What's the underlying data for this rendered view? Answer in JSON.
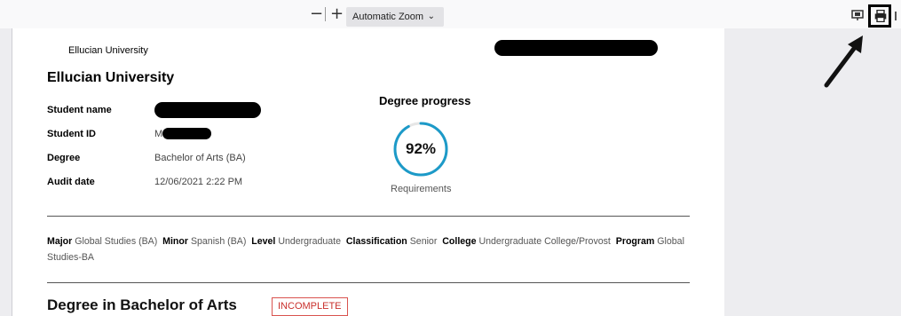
{
  "toolbar": {
    "zoom_out": "−",
    "zoom_in": "+",
    "zoom_value": "Automatic Zoom",
    "zoom_chevron": "⌄"
  },
  "page": {
    "institution_small": "Ellucian University",
    "institution_title": "Ellucian University",
    "fields": [
      {
        "label": "Student name",
        "value": ""
      },
      {
        "label": "Student ID",
        "value": "M"
      },
      {
        "label": "Degree",
        "value": "Bachelor of Arts (BA)"
      },
      {
        "label": "Audit date",
        "value": "12/06/2021  2:22 PM"
      }
    ],
    "progress": {
      "title": "Degree progress",
      "percent_text": "92%",
      "percent": 0.92,
      "caption": "Requirements"
    },
    "program": [
      {
        "label": "Major",
        "value": "Global Studies (BA)"
      },
      {
        "label": "Minor",
        "value": "Spanish (BA)"
      },
      {
        "label": "Level",
        "value": "Undergraduate"
      },
      {
        "label": "Classification",
        "value": "Senior"
      },
      {
        "label": "College",
        "value": "Undergraduate College/Provost"
      },
      {
        "label": "Program",
        "value": "Global Studies-BA"
      }
    ],
    "degree_heading": "Degree in Bachelor of Arts",
    "degree_status": "INCOMPLETE"
  },
  "colors": {
    "ring": "#1c9ac8",
    "status": "#c9302c"
  }
}
